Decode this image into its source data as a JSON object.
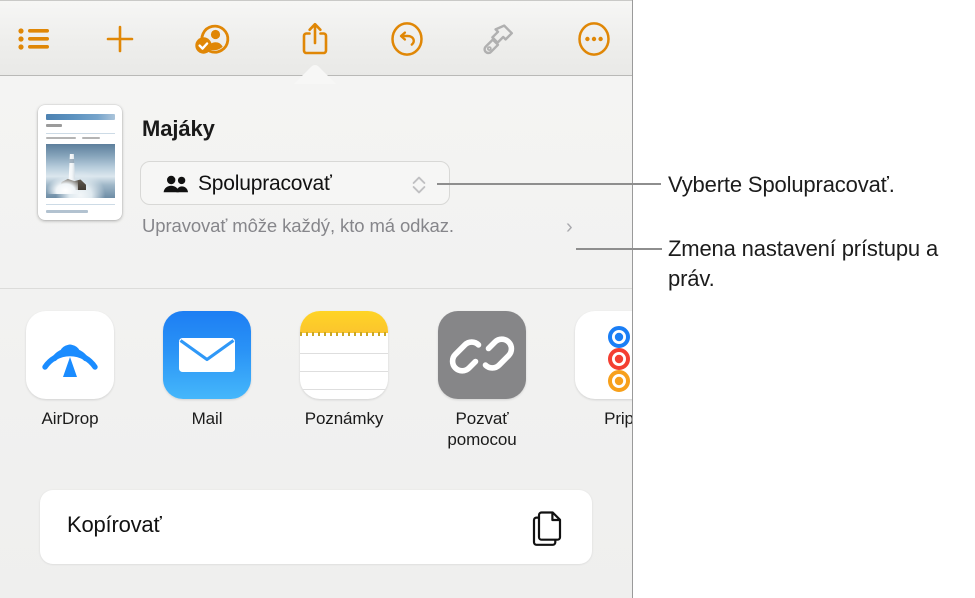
{
  "toolbar": {
    "items": [
      {
        "name": "list-view-button",
        "icon": "bulleted-list-icon",
        "state": "enabled"
      },
      {
        "name": "insert-button",
        "icon": "plus-icon",
        "state": "enabled"
      },
      {
        "name": "collaborate-button",
        "icon": "person-check-icon",
        "state": "enabled"
      },
      {
        "name": "share-button",
        "icon": "share-up-arrow-icon",
        "state": "active"
      },
      {
        "name": "undo-button",
        "icon": "undo-circle-icon",
        "state": "enabled"
      },
      {
        "name": "format-button",
        "icon": "paintbrush-icon",
        "state": "disabled"
      },
      {
        "name": "more-button",
        "icon": "ellipsis-circle-icon",
        "state": "enabled"
      }
    ],
    "accent_color": "#e08706",
    "disabled_color": "#b0b0b0"
  },
  "share_sheet": {
    "document_title": "Majáky",
    "thumbnail_alt": "lighthouse-document-thumbnail",
    "collaborate": {
      "label": "Spolupracovať",
      "icon": "two-people-icon",
      "chevron": "up-down-chevron-icon"
    },
    "permission": {
      "text": "Upravovať môže každý, kto má odkaz.",
      "chevron": "chevron-right-icon"
    },
    "apps": [
      {
        "label": "AirDrop",
        "icon": "airdrop-icon"
      },
      {
        "label": "Mail",
        "icon": "mail-icon"
      },
      {
        "label": "Poznámky",
        "icon": "notes-icon"
      },
      {
        "label": "Pozvať pomocou",
        "icon": "link-chain-icon"
      },
      {
        "label": "Prip",
        "icon": "reminders-icon"
      }
    ],
    "actions": [
      {
        "label": "Kopírovať",
        "icon": "copy-pages-icon"
      }
    ]
  },
  "annotations": [
    {
      "text": "Vyberte Spolupracovať."
    },
    {
      "text": "Zmena nastavení prístupu a práv."
    }
  ]
}
